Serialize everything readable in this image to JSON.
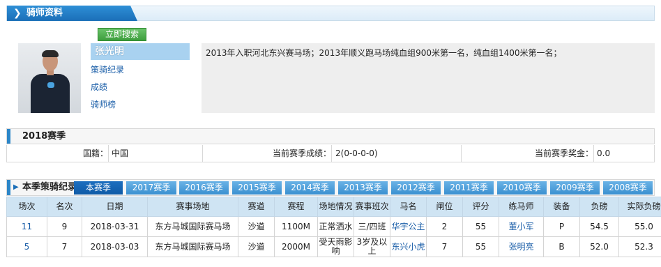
{
  "header": {
    "title": "骑师资料"
  },
  "search_button": "立即搜索",
  "jockey": {
    "name": "张光明",
    "bio": "2013年入职河北东兴赛马场；2013年顺义跑马场纯血组900米第一名，纯血组1400米第一名；"
  },
  "side_links": [
    "策骑纪录",
    "成绩",
    "骑师榜"
  ],
  "season_summary": {
    "title": "2018赛季",
    "nationality_label": "国籍：",
    "nationality_value": "中国",
    "score_label": "当前赛季成绩：",
    "score_value": "2(0-0-0-0)",
    "prize_label": "当前赛季奖金：",
    "prize_value": "0.0"
  },
  "records": {
    "title": "本季策骑纪录",
    "tabs": [
      "本赛季",
      "2017赛季",
      "2016赛季",
      "2015赛季",
      "2014赛季",
      "2013赛季",
      "2012赛季",
      "2011赛季",
      "2010赛季",
      "2009赛季",
      "2008赛季"
    ],
    "columns": [
      "场次",
      "名次",
      "日期",
      "赛事场地",
      "赛道",
      "赛程",
      "场地情况",
      "赛事班次",
      "马名",
      "闸位",
      "评分",
      "练马师",
      "装备",
      "负磅",
      "实际负磅"
    ],
    "rows": [
      {
        "race": "11",
        "place": "9",
        "date": "2018-03-31",
        "venue": "东方马城国际赛马场",
        "track": "沙道",
        "distance": "1100M",
        "going": "正常洒水",
        "class": "三/四班",
        "horse": "华宇公主",
        "draw": "2",
        "rating": "55",
        "trainer": "董小军",
        "gear": "P",
        "weight": "54.5",
        "actual_weight": "55.0"
      },
      {
        "race": "5",
        "place": "7",
        "date": "2018-03-03",
        "venue": "东方马城国际赛马场",
        "track": "沙道",
        "distance": "2000M",
        "going": "受天雨影响",
        "class": "3岁及以上",
        "horse": "东兴小虎",
        "draw": "7",
        "rating": "55",
        "trainer": "张明亮",
        "gear": "B",
        "weight": "52.0",
        "actual_weight": "52.3"
      }
    ]
  },
  "colors": {
    "accent": "#1b6fb8",
    "header_bg": "#cfe4f3",
    "bio_bg": "#eeeeee"
  }
}
